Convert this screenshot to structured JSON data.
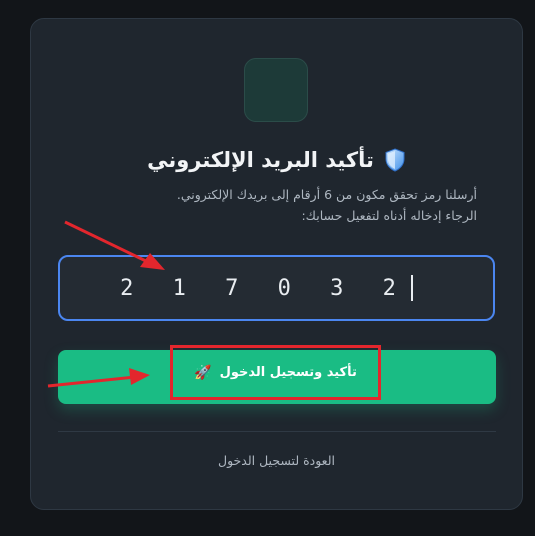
{
  "page": {
    "title": "تأكيد البريد الإلكتروني",
    "title_icon": "shield-icon",
    "description_line1": "أرسلنا رمز تحقق مكون من 6 أرقام إلى بريدك الإلكتروني.",
    "description_line2": "الرجاء إدخاله أدناه لتفعيل حسابك:"
  },
  "code_input": {
    "value": "2 1 7 0 3 2"
  },
  "submit": {
    "label": "تأكيد وتسجيل الدخول",
    "icon": "rocket-icon"
  },
  "back_link": {
    "label": "العودة لتسجيل الدخول"
  },
  "colors": {
    "accent": "#1abc84",
    "focus_border": "#4b86f0",
    "annotation": "#e3262d"
  }
}
